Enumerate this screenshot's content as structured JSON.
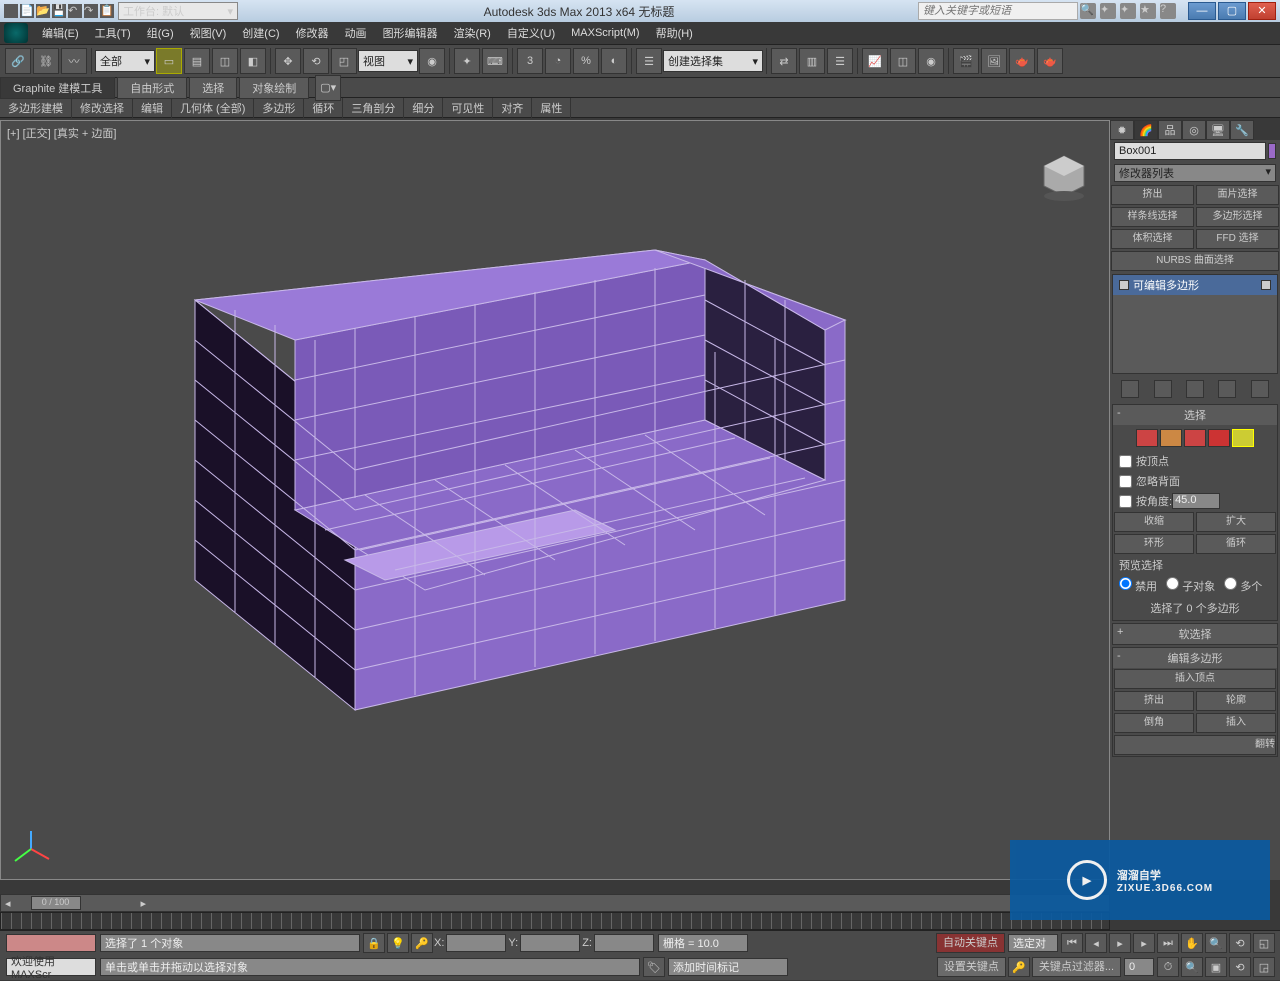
{
  "titlebar": {
    "workspace_label": "工作台: 默认",
    "app_title": "Autodesk 3ds Max  2013 x64    无标题",
    "search_placeholder": "键入关键字或短语"
  },
  "menubar": {
    "items": [
      "编辑(E)",
      "工具(T)",
      "组(G)",
      "视图(V)",
      "创建(C)",
      "修改器",
      "动画",
      "图形编辑器",
      "渲染(R)",
      "自定义(U)",
      "MAXScript(M)",
      "帮助(H)"
    ]
  },
  "toolbar": {
    "filter_all": "全部",
    "view_label": "视图",
    "named_set": "创建选择集"
  },
  "ribbon": {
    "tabs": [
      "Graphite 建模工具",
      "自由形式",
      "选择",
      "对象绘制"
    ],
    "subs": [
      "多边形建模",
      "修改选择",
      "编辑",
      "几何体 (全部)",
      "多边形",
      "循环",
      "三角剖分",
      "细分",
      "可见性",
      "对齐",
      "属性"
    ]
  },
  "viewport": {
    "label": "[+] [正交] [真实 + 边面]"
  },
  "modpanel": {
    "object_name": "Box001",
    "modifier_list": "修改器列表",
    "btns": [
      "挤出",
      "面片选择",
      "样条线选择",
      "多边形选择",
      "体积选择",
      "FFD 选择"
    ],
    "nurbs": "NURBS 曲面选择",
    "stack_item": "可编辑多边形"
  },
  "selection": {
    "header": "选择",
    "by_vertex": "按顶点",
    "ignore_back": "忽略背面",
    "by_angle": "按角度:",
    "angle_val": "45.0",
    "shrink": "收缩",
    "grow": "扩大",
    "ring": "环形",
    "loop": "循环",
    "preview": "预览选择",
    "disable": "禁用",
    "subobj": "子对象",
    "multi": "多个",
    "status": "选择了 0 个多边形"
  },
  "softsel": {
    "header": "软选择"
  },
  "editpoly": {
    "header": "编辑多边形",
    "insert_vert": "插入顶点",
    "extrude": "挤出",
    "outline": "轮廓",
    "bevel": "倒角",
    "inset": "插入",
    "flip": "翻转"
  },
  "status": {
    "welcome": "欢迎使用  MAXScr",
    "sel": "选择了 1 个对象",
    "prompt": "单击或单击并拖动以选择对象",
    "x": "X:",
    "y": "Y:",
    "z": "Z:",
    "grid": "栅格 = 10.0",
    "add_time": "添加时间标记",
    "autokey": "自动关键点",
    "setkey": "设置关键点",
    "select_filter": "选定对",
    "keyfilter": "关键点过滤器..."
  },
  "timeline": {
    "frame": "0 / 100"
  },
  "watermark": {
    "main": "溜溜自学",
    "sub": "ZIXUE.3D66.COM"
  }
}
